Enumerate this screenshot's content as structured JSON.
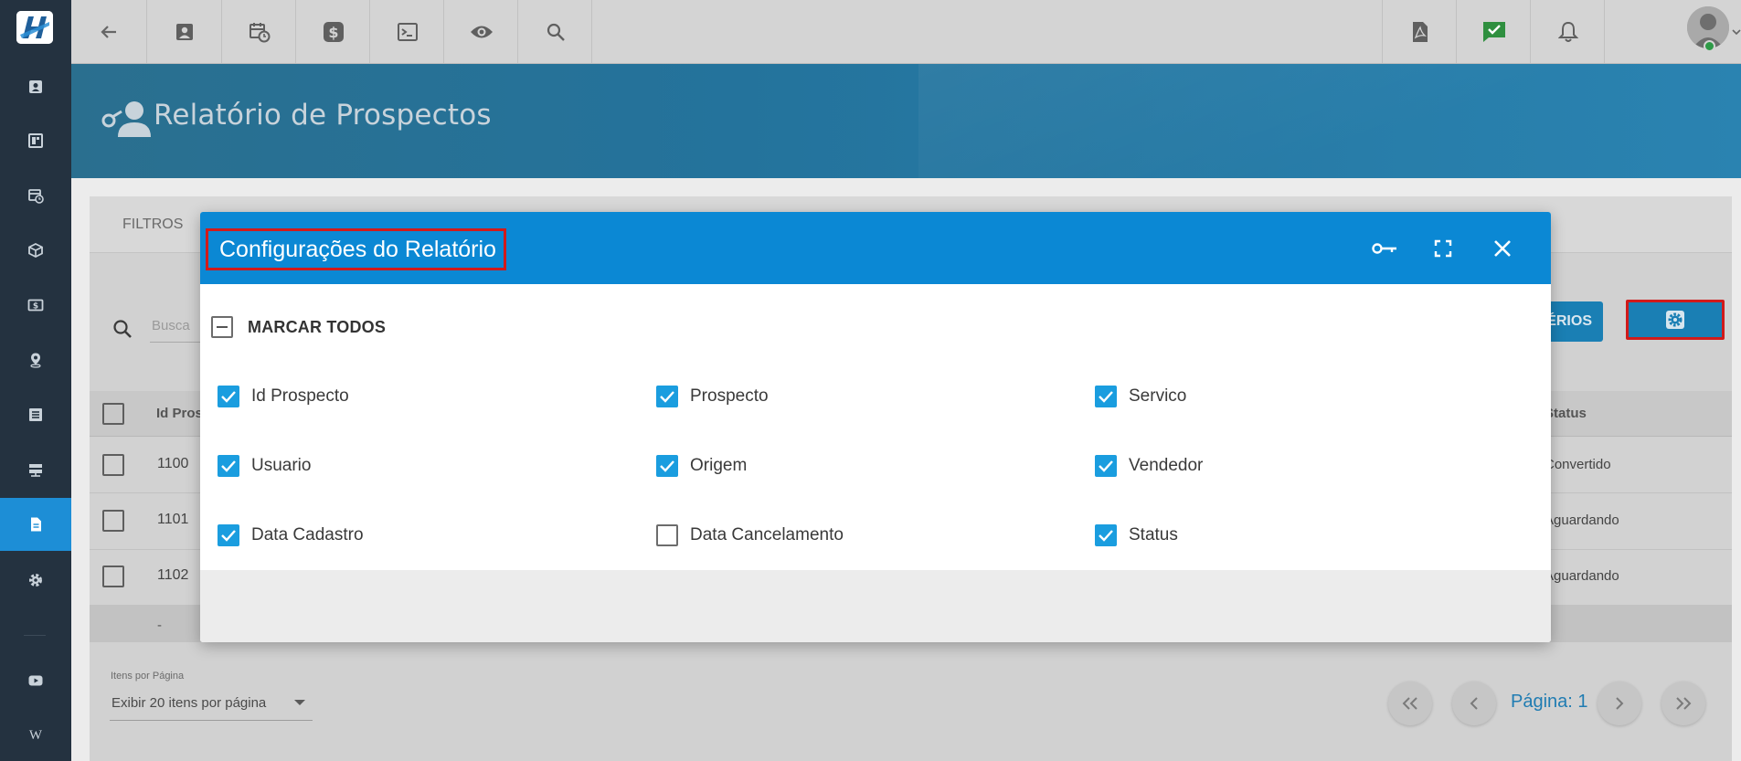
{
  "colors": {
    "accent": "#0b88d4",
    "sidebar": "#243240",
    "active_item": "#1d8ed6",
    "highlight": "#d11a1a",
    "checked": "#1a9ddf"
  },
  "sidebar": {
    "items": [
      {
        "icon": "contact-card-icon"
      },
      {
        "icon": "dashboard-icon"
      },
      {
        "icon": "calendar-clock-icon"
      },
      {
        "icon": "box-icon"
      },
      {
        "icon": "money-icon"
      },
      {
        "icon": "map-pin-icon"
      },
      {
        "icon": "list-icon"
      },
      {
        "icon": "server-icon"
      },
      {
        "icon": "document-icon",
        "active": true
      },
      {
        "icon": "gear-icon"
      },
      {
        "icon": "youtube-icon"
      },
      {
        "icon": "wikipedia-icon",
        "glyph": "W"
      }
    ]
  },
  "topbar": {
    "icons": [
      "back-arrow-icon",
      "contact-card-icon",
      "calendar-clock-icon",
      "dollar-icon",
      "terminal-icon",
      "eye-icon",
      "search-icon",
      "pdf-icon",
      "chat-check-icon",
      "bell-icon",
      "avatar-icon",
      "menu-list-icon"
    ]
  },
  "page": {
    "title": "Relatório de Prospectos"
  },
  "filters": {
    "tab_label": "FILTROS",
    "search_placeholder": "Busca",
    "criterios_label": "ÉRIOS"
  },
  "table": {
    "headers": {
      "id": "Id Pros",
      "status": "Status"
    },
    "rows": [
      {
        "id": "1100",
        "status": "Convertido"
      },
      {
        "id": "1101",
        "status": "Aguardando"
      },
      {
        "id": "1102",
        "status": "Aguardando"
      }
    ],
    "footer_dash": "-"
  },
  "pagination": {
    "per_page_label": "Itens por Página",
    "per_page_value": "Exibir 20 itens por página",
    "page_label": "Página: 1"
  },
  "modal": {
    "title": "Configurações do Relatório",
    "select_all_label": "MARCAR TODOS",
    "options": [
      {
        "label": "Id Prospecto",
        "checked": true
      },
      {
        "label": "Prospecto",
        "checked": true
      },
      {
        "label": "Servico",
        "checked": true
      },
      {
        "label": "Usuario",
        "checked": true
      },
      {
        "label": "Origem",
        "checked": true
      },
      {
        "label": "Vendedor",
        "checked": true
      },
      {
        "label": "Data Cadastro",
        "checked": true
      },
      {
        "label": "Data Cancelamento",
        "checked": false
      },
      {
        "label": "Status",
        "checked": true
      }
    ]
  }
}
